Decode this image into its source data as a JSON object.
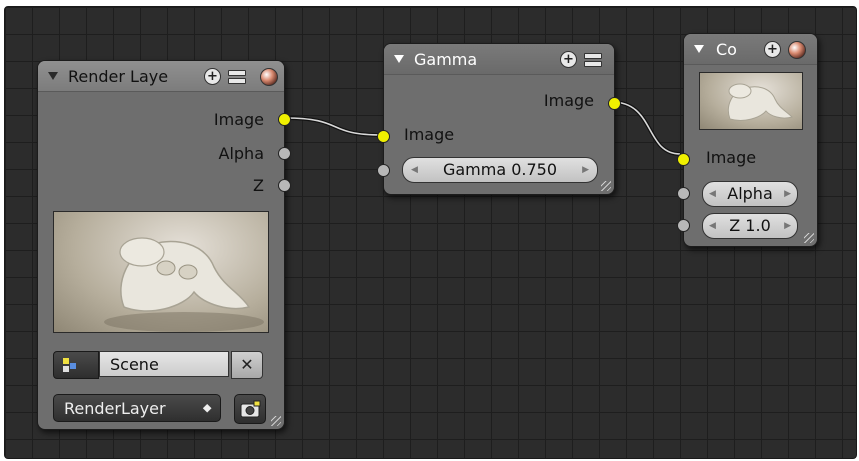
{
  "nodes": {
    "render_layers": {
      "title": "Render Laye",
      "outputs": [
        {
          "label": "Image",
          "socket": "yellow"
        },
        {
          "label": "Alpha",
          "socket": "grey"
        },
        {
          "label": "Z",
          "socket": "grey"
        }
      ],
      "scene": {
        "value": "Scene",
        "clear_label": "✕"
      },
      "layer_select": {
        "value": "RenderLayer",
        "arrows": "⯁"
      }
    },
    "gamma": {
      "title": "Gamma",
      "output": {
        "label": "Image"
      },
      "input": {
        "label": "Image"
      },
      "gamma_field": {
        "text": "Gamma 0.750",
        "value": 0.75
      }
    },
    "composite": {
      "title": "Co",
      "input": {
        "label": "Image"
      },
      "alpha_field": {
        "text": "Alpha"
      },
      "z_field": {
        "text": "Z 1.0",
        "value": 1.0
      }
    }
  },
  "icons": {
    "collapse": "triangle-down-icon",
    "add": "plus-icon",
    "toggle": "toggle-icon",
    "preview_sphere": "material-sphere-icon",
    "scene": "scene-icon",
    "camera": "camera-icon"
  },
  "colors": {
    "socket_color_image": "#f0f000",
    "socket_color_value": "#b8b8b8",
    "node_body": "#6e6e6e",
    "editor_bg": "#2c2c2c"
  }
}
